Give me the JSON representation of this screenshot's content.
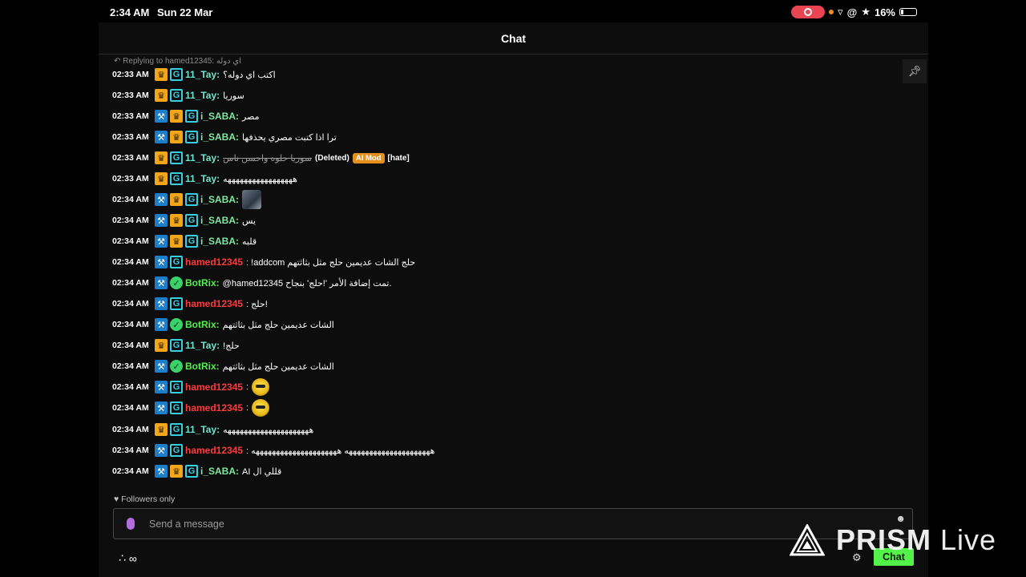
{
  "status_bar": {
    "time": "2:34 AM",
    "date": "Sun 22 Mar",
    "battery": "16%"
  },
  "header": {
    "title": "Chat"
  },
  "reply_context": "Replying to hamed12345: اي دوله",
  "messages": [
    {
      "time": "02:33 AM",
      "user": "11_Tay:",
      "text": "اكتب اي دوله؟"
    },
    {
      "time": "02:33 AM",
      "user": "11_Tay:",
      "text": "سوريا"
    },
    {
      "time": "02:33 AM",
      "user": "i_SABA:",
      "text": "مصر"
    },
    {
      "time": "02:33 AM",
      "user": "i_SABA:",
      "text": "ترا اذا كتبت مصري يحذفها"
    },
    {
      "time": "02:33 AM",
      "user": "11_Tay:",
      "text": "سوريا حلوه واحسن ناس",
      "deleted_label": "(Deleted)",
      "badge": "AI Mod",
      "tag": "[hate]"
    },
    {
      "time": "02:33 AM",
      "user": "11_Tay:",
      "text": "هههههههههههههههههه"
    },
    {
      "time": "02:34 AM",
      "user": "i_SABA:",
      "text": ""
    },
    {
      "time": "02:34 AM",
      "user": "i_SABA:",
      "text": "يس"
    },
    {
      "time": "02:34 AM",
      "user": "i_SABA:",
      "text": "قلبه"
    },
    {
      "time": "02:34 AM",
      "user": "hamed12345",
      "text": ": !addcom حلج الشات عديمين حلج مثل بثاثتهم"
    },
    {
      "time": "02:34 AM",
      "user": "BotRix:",
      "text": "@hamed12345 تمت إضافة الأمر '!حلج' بنجاح."
    },
    {
      "time": "02:34 AM",
      "user": "hamed12345",
      "text": ": حلج!"
    },
    {
      "time": "02:34 AM",
      "user": "BotRix:",
      "text": "الشات عديمين حلج مثل بثاثتهم"
    },
    {
      "time": "02:34 AM",
      "user": "11_Tay:",
      "text": "حلج!"
    },
    {
      "time": "02:34 AM",
      "user": "BotRix:",
      "text": "الشات عديمين حلج مثل بثاثتهم"
    },
    {
      "time": "02:34 AM",
      "user": "hamed12345",
      "text": ":"
    },
    {
      "time": "02:34 AM",
      "user": "hamed12345",
      "text": ":"
    },
    {
      "time": "02:34 AM",
      "user": "11_Tay:",
      "text": "هههههههههههههههههههههه"
    },
    {
      "time": "02:34 AM",
      "user": "hamed12345",
      "text": ": هههههههههههههههههههههه هههههههههههههههههههههه"
    },
    {
      "time": "02:34 AM",
      "user": "i_SABA:",
      "text": "قللي ال AI"
    }
  ],
  "followers_only": "Followers only",
  "input": {
    "placeholder": "Send a message"
  },
  "chat_button": "Chat",
  "logo": {
    "word1": "PRISM",
    "word2": " Live"
  },
  "colors": {
    "accent_green": "#53f24b",
    "vip_gold": "#f2a71b",
    "mod_blue": "#1e7fc8",
    "og_cyan": "#36cfe0",
    "user_red": "#ff3a3a"
  },
  "icons": [
    "reply-icon",
    "pin-icon",
    "mod-hammer-icon",
    "vip-crown-icon",
    "og-badge-icon",
    "verified-bot-icon",
    "heart-icon",
    "mic-icon",
    "emoji-icon",
    "infinity-icon",
    "gear-icon",
    "wifi-icon",
    "star-icon",
    "battery-icon"
  ]
}
